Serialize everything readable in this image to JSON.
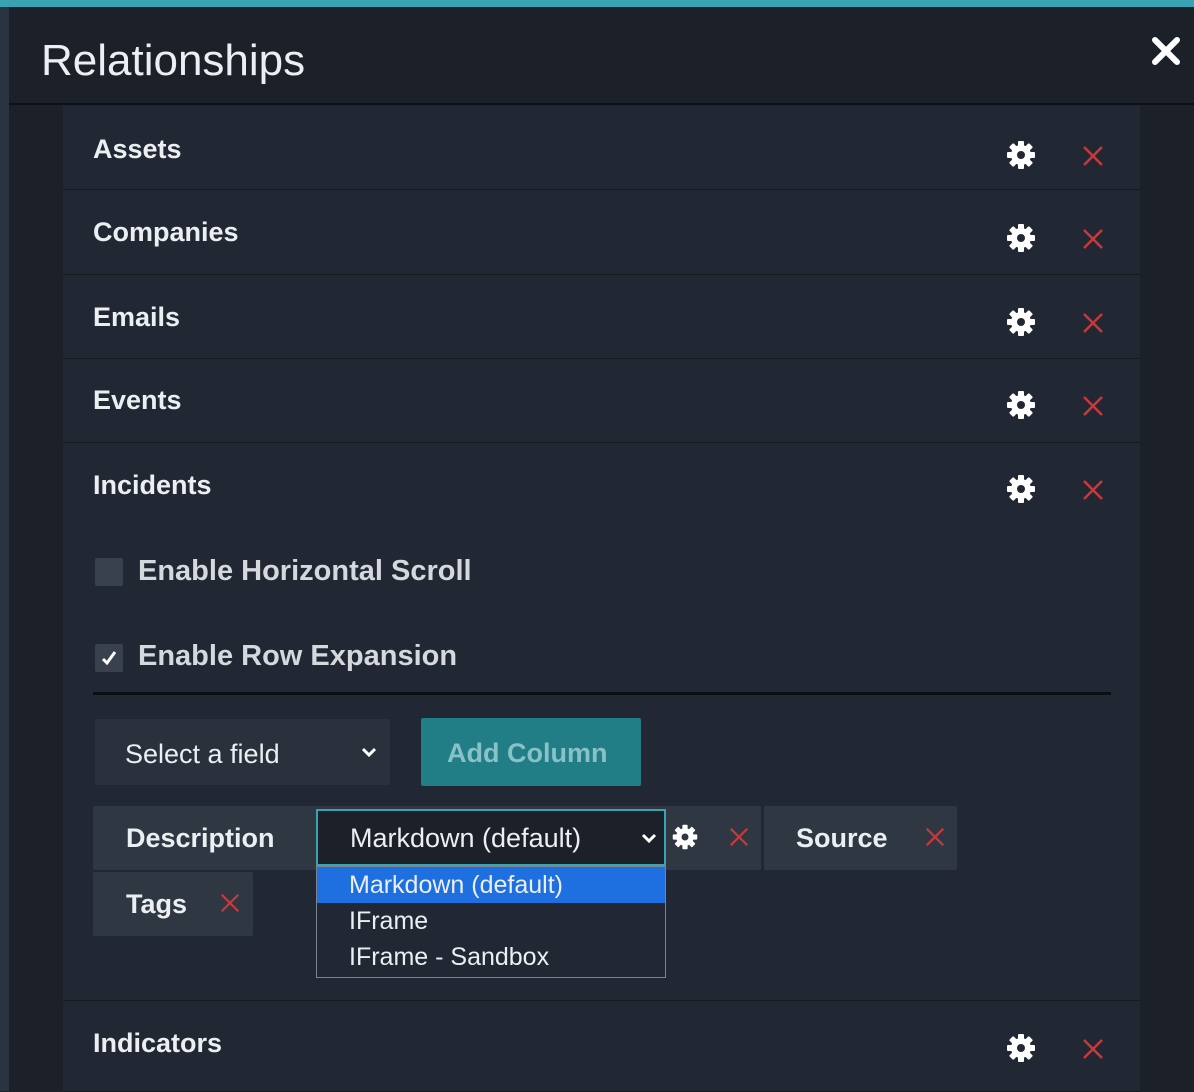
{
  "dialog": {
    "title": "Relationships",
    "close_icon": "close-icon"
  },
  "relationships": [
    {
      "label": "Assets"
    },
    {
      "label": "Companies"
    },
    {
      "label": "Emails"
    },
    {
      "label": "Events"
    },
    {
      "label": "Incidents"
    },
    {
      "label": "Indicators"
    }
  ],
  "incidents_settings": {
    "horizontal_scroll": {
      "label": "Enable Horizontal Scroll",
      "checked": false
    },
    "row_expansion": {
      "label": "Enable Row Expansion",
      "checked": true
    },
    "field_select": {
      "selected": "Select a field"
    },
    "add_column_label": "Add Column",
    "columns": [
      {
        "label": "Description",
        "renderer": "Markdown (default)"
      },
      {
        "label": "Source"
      },
      {
        "label": "Tags"
      }
    ],
    "renderer_options": [
      "Markdown (default)",
      "IFrame",
      "IFrame - Sandbox"
    ]
  },
  "colors": {
    "accent": "#3aa3b2",
    "add_column_bg": "#217d86",
    "delete_red": "#c9383a",
    "selected_option": "#1e6fe0"
  }
}
